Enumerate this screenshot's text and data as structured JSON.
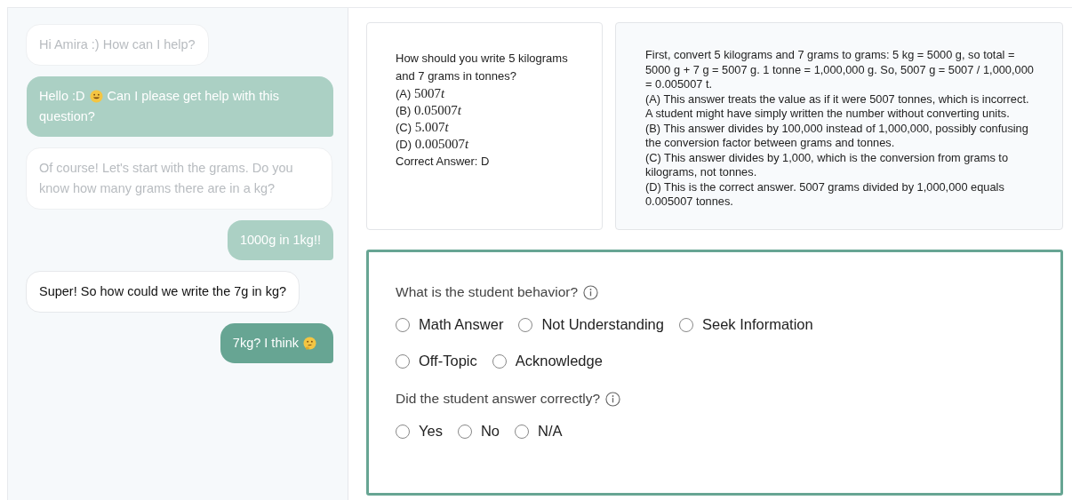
{
  "chat": {
    "messages": [
      {
        "kind": "tutor",
        "faded": true,
        "text": "Hi Amira :) How can I help?"
      },
      {
        "kind": "student",
        "faded": true,
        "parts": [
          {
            "kind": "text",
            "text": "Hello :D"
          },
          {
            "kind": "grin"
          },
          {
            "kind": "text",
            "text": "Can I please get help with this"
          },
          {
            "kind": "text",
            "text": "question?"
          }
        ]
      },
      {
        "kind": "tutor",
        "faded": true,
        "text": "Of course! Let's start with the grams. Do you know how many grams there are in a kg?"
      },
      {
        "kind": "student",
        "faded": true,
        "text": "1000g in 1kg!!"
      },
      {
        "kind": "tutor",
        "faded": false,
        "text": "Super! So how could we write the 7g in kg?"
      },
      {
        "kind": "student",
        "faded": false,
        "parts": [
          {
            "kind": "text",
            "text": "7kg? I think"
          },
          {
            "kind": "thinking"
          }
        ]
      }
    ]
  },
  "question": {
    "text": "How should you write 5 kilograms and 7 grams in tonnes?",
    "options": [
      {
        "letter": "(A)",
        "value": "5007",
        "unit": "t"
      },
      {
        "letter": "(B)",
        "value": "0.05007",
        "unit": "t"
      },
      {
        "letter": "(C)",
        "value": "5.007",
        "unit": "t"
      },
      {
        "letter": "(D)",
        "value": "0.005007",
        "unit": "t"
      }
    ],
    "correct_answer": "Correct Answer: D"
  },
  "explanation": {
    "paragraphs": [
      "First, convert 5 kilograms and 7 grams to grams: 5 kg = 5000 g, so total = 5000 g + 7 g = 5007 g. 1 tonne = 1,000,000 g. So, 5007 g = 5007 / 1,000,000 = 0.005007 t.",
      "(A) This answer treats the value as if it were 5007 tonnes, which is incorrect. A student might have simply written the number without converting units.",
      "(B) This answer divides by 100,000 instead of 1,000,000, possibly confusing the conversion factor between grams and tonnes.",
      "(C) This answer divides by 1,000, which is the conversion from grams to kilograms, not tonnes.",
      "(D) This is the correct answer. 5007 grams divided by 1,000,000 equals 0.005007 tonnes."
    ]
  },
  "form": {
    "questions": [
      {
        "label": "What is the student behavior?",
        "options": [
          {
            "label": "Math Answer",
            "selected": false
          },
          {
            "label": "Not Understanding",
            "selected": false
          },
          {
            "label": "Seek Information",
            "selected": false
          },
          {
            "label": "Off-Topic",
            "selected": false
          },
          {
            "label": "Acknowledge",
            "selected": false
          }
        ]
      },
      {
        "label": "Did the student answer correctly?",
        "options": [
          {
            "label": "Yes",
            "selected": false
          },
          {
            "label": "No",
            "selected": false
          },
          {
            "label": "N/A",
            "selected": false
          }
        ]
      }
    ]
  }
}
